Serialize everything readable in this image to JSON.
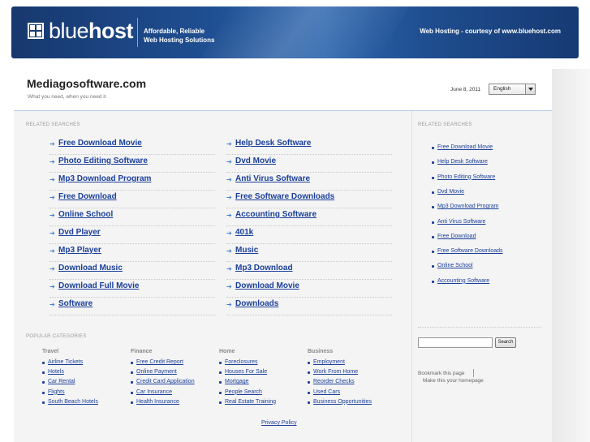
{
  "banner": {
    "logo_light": "blue",
    "logo_bold": "host",
    "tagline_line1": "Affordable, Reliable",
    "tagline_line2": "Web Hosting Solutions",
    "courtesy": "Web Hosting - courtesy of www.bluehost.com"
  },
  "header": {
    "title": "Mediagosoftware.com",
    "subtitle": "What you need, when you need it",
    "date": "June 8, 2011",
    "language": "English"
  },
  "related": {
    "label": "RELATED SEARCHES",
    "left": [
      "Free Download Movie",
      "Photo Editing Software",
      "Mp3 Download Program",
      "Free Download",
      "Online School",
      "Dvd Player",
      "Mp3 Player",
      "Download Music",
      "Download Full Movie",
      "Software"
    ],
    "right": [
      "Help Desk Software",
      "Dvd Movie",
      "Anti Virus Software",
      "Free Software Downloads",
      "Accounting Software",
      "401k",
      "Music",
      "Mp3 Download",
      "Download Movie",
      "Downloads"
    ]
  },
  "sidebar": {
    "label": "RELATED SEARCHES",
    "items": [
      "Free Download Movie",
      "Help Desk Software",
      "Photo Editing Software",
      "Dvd Movie",
      "Mp3 Download Program",
      "Anti Virus Software",
      "Free Download",
      "Free Software Downloads",
      "Online School",
      "Accounting Software"
    ],
    "search_button": "Search",
    "bookmark": "Bookmark this page",
    "homepage": "Make this your homepage"
  },
  "popular": {
    "label": "POPULAR CATEGORIES",
    "categories": [
      {
        "name": "Travel",
        "links": [
          "Airline Tickets",
          "Hotels",
          "Car Rental",
          "Flights",
          "South Beach Hotels"
        ]
      },
      {
        "name": "Finance",
        "links": [
          "Free Credit Report",
          "Online Payment",
          "Credit Card Application",
          "Car Insurance",
          "Health Insurance"
        ]
      },
      {
        "name": "Home",
        "links": [
          "Foreclosures",
          "Houses For Sale",
          "Mortgage",
          "People Search",
          "Real Estate Training"
        ]
      },
      {
        "name": "Business",
        "links": [
          "Employment",
          "Work From Home",
          "Reorder Checks",
          "Used Cars",
          "Business Opportunities"
        ]
      }
    ]
  },
  "footer": {
    "privacy": "Privacy Policy"
  }
}
